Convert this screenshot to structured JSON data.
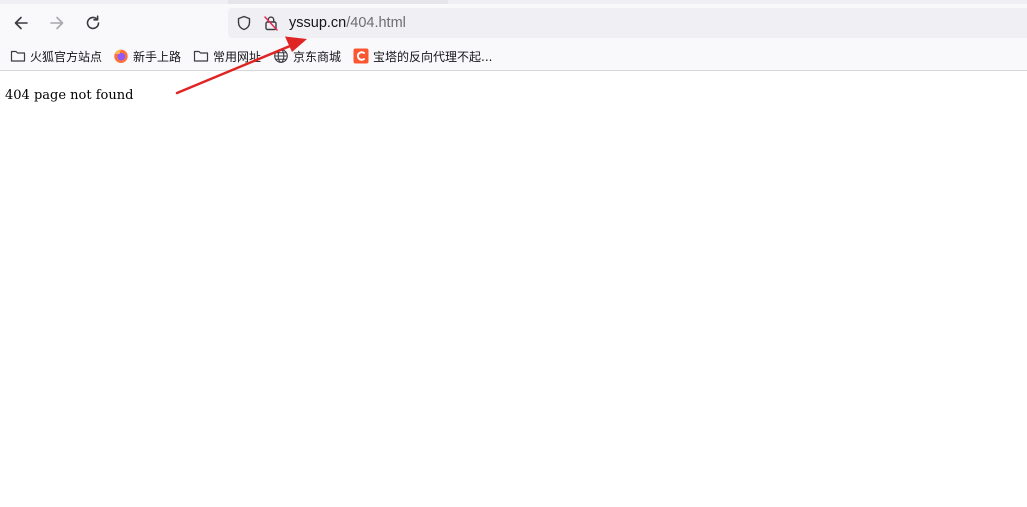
{
  "browser": {
    "url_host": "yssup.cn",
    "url_path": "/404.html",
    "accent_color": "#e02424"
  },
  "icons": {
    "back": "back-arrow-icon",
    "forward": "forward-arrow-icon",
    "reload": "reload-icon",
    "tracking": "shield-icon",
    "security": "insecure-lock-icon"
  },
  "bookmarks": [
    {
      "label": "火狐官方站点",
      "icon": "folder-icon"
    },
    {
      "label": "新手上路",
      "icon": "firefox-icon"
    },
    {
      "label": "常用网址",
      "icon": "folder-icon"
    },
    {
      "label": "京东商城",
      "icon": "globe-icon"
    },
    {
      "label": "宝塔的反向代理不起...",
      "icon": "c-logo-icon"
    }
  ],
  "page": {
    "message": "404 page not found"
  }
}
